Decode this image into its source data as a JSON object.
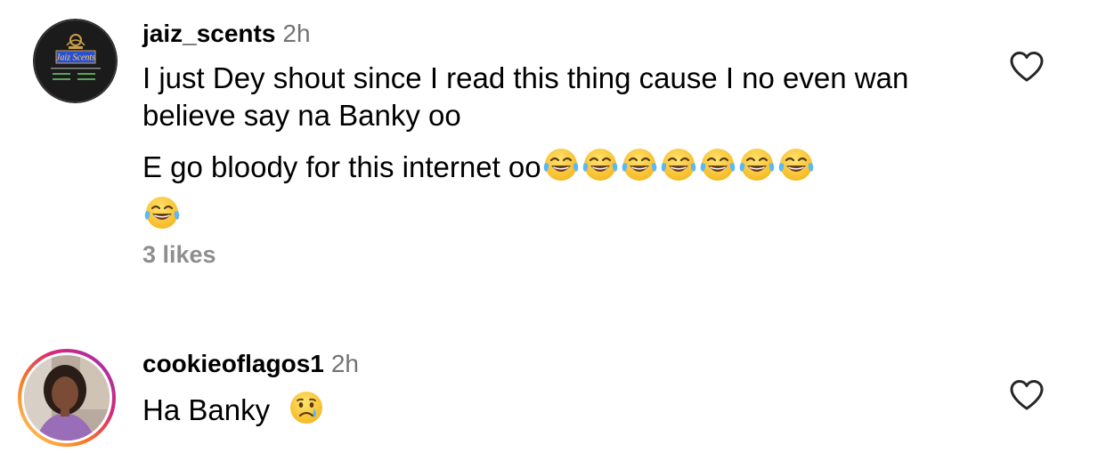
{
  "comments": [
    {
      "username": "jaiz_scents",
      "time": "2h",
      "avatar": {
        "brand": "Jaiz Scents",
        "icon": "jaiz-scents-logo",
        "colors": [
          "#1a1a1a",
          "#c9a04a",
          "#3d6ef0"
        ]
      },
      "text_line1": "I just Dey shout since I read this thing cause I no even wan believe say na Banky oo",
      "text_line2": "E go bloody for this internet oo",
      "emojis": [
        "tears-of-joy",
        "tears-of-joy",
        "tears-of-joy",
        "tears-of-joy",
        "tears-of-joy",
        "tears-of-joy",
        "tears-of-joy",
        "tears-of-joy"
      ],
      "likes": "3 likes",
      "like_icon": "heart-outline-icon"
    },
    {
      "username": "cookieoflagos1",
      "time": "2h",
      "avatar": {
        "icon": "profile-photo",
        "story_ring": true
      },
      "text": "Ha Banky",
      "emojis": [
        "crying-face"
      ],
      "like_icon": "heart-outline-icon"
    }
  ]
}
